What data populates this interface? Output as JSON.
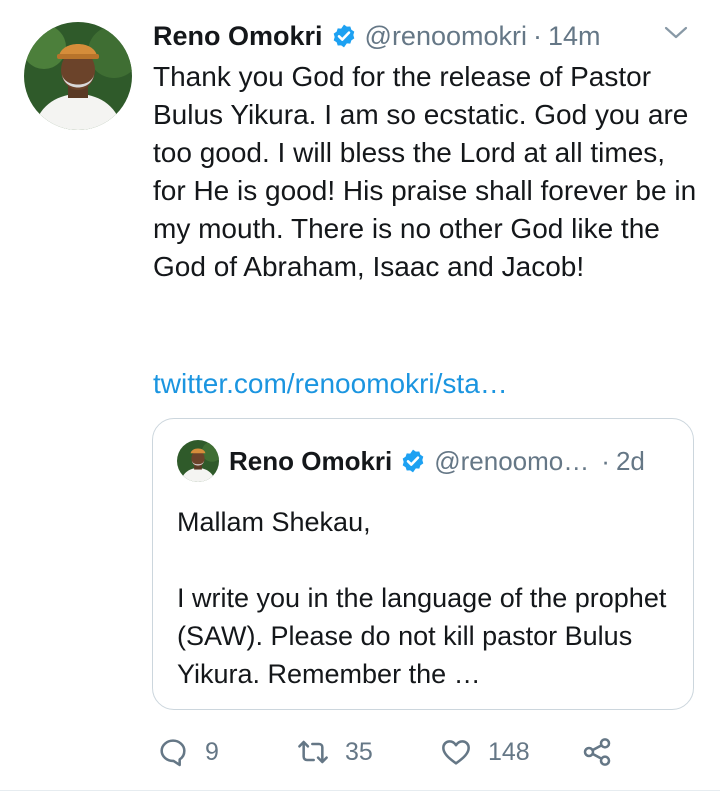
{
  "tweet": {
    "author_name": "Reno Omokri",
    "handle": "@renoomokri",
    "separator": "·",
    "time": "14m",
    "text": "Thank you God for the release of Pastor Bulus Yikura. I am so ecstatic. God you are too good. I will bless the Lord at all times, for He is good! His praise shall forever be in my mouth. There is no other God like the God of Abraham, Isaac and Jacob!",
    "link": "twitter.com/renoomokri/sta…"
  },
  "quoted_tweet": {
    "author_name": "Reno Omokri",
    "handle": "@renoomo…",
    "separator": "·",
    "time": "2d",
    "text_line1": "Mallam Shekau,",
    "text_line2": "I write you in the language of the prophet (SAW). Please do not kill pastor Bulus Yikura. Remember the …"
  },
  "actions": {
    "replies": "9",
    "retweets": "35",
    "likes": "148"
  },
  "colors": {
    "verified": "#1da1f2",
    "link": "#1b95e0",
    "muted": "#657786",
    "border": "#ccd6dd"
  },
  "icons": [
    "verified-badge-icon",
    "chevron-down-icon",
    "reply-icon",
    "retweet-icon",
    "like-icon",
    "share-icon"
  ]
}
